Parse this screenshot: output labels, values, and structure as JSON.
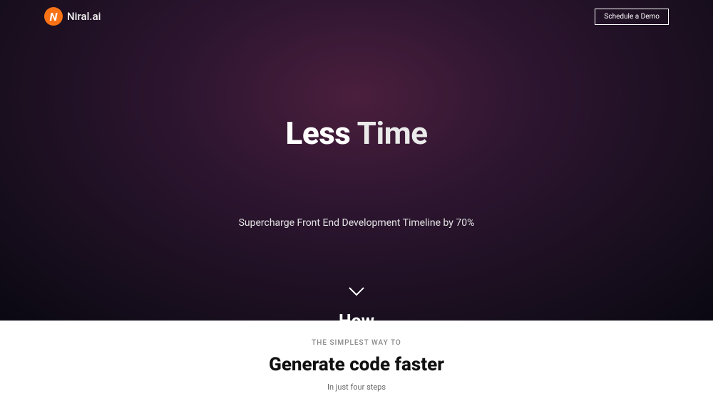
{
  "header": {
    "logo_text": "Niral.ai",
    "logo_letter": "N",
    "demo_button": "Schedule a Demo"
  },
  "hero": {
    "title_part1": "Less",
    "title_part2": " Time",
    "subtitle": "Supercharge Front End Development Timeline by 70%",
    "how_label": "How"
  },
  "section2": {
    "eyebrow": "THE SIMPLEST WAY TO",
    "title": "Generate code faster",
    "subtitle": "In just four steps"
  }
}
